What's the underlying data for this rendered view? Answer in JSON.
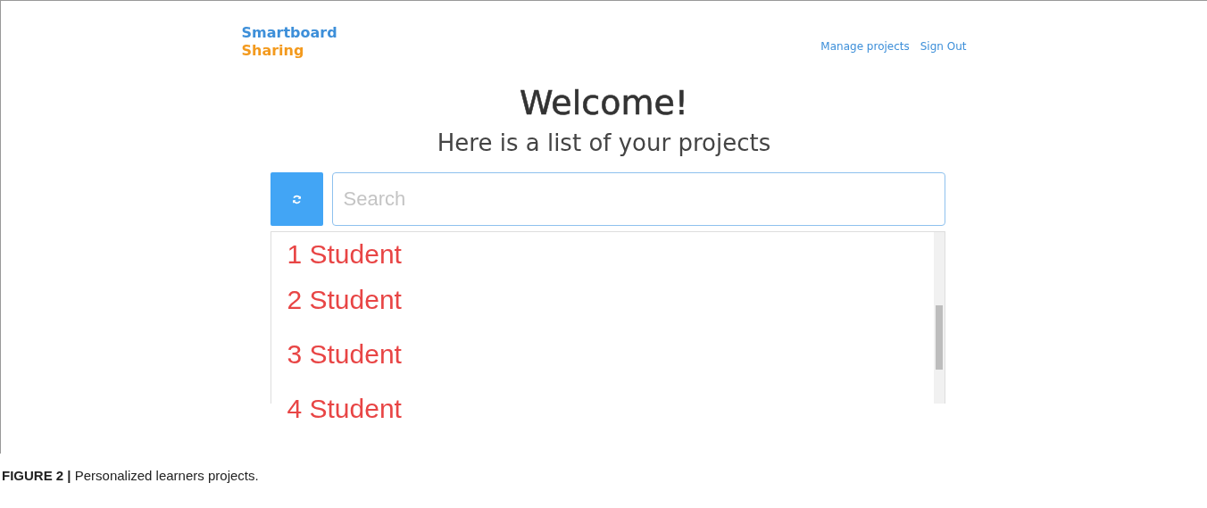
{
  "header": {
    "logo": {
      "line_1": "Smartboard",
      "line_2": "Sharing"
    },
    "nav": [
      "Manage projects",
      "Sign Out"
    ]
  },
  "welcome": {
    "title": "Welcome!",
    "subtitle": "Here is a list of your projects"
  },
  "search": {
    "placeholder": "Search"
  },
  "projects": [
    {
      "label": "1 Student"
    },
    {
      "label": "2 Student"
    },
    {
      "label": "3 Student"
    },
    {
      "label": "4 Student"
    }
  ],
  "caption": "**FIGURE 2 |** Personalized learners projects."
}
